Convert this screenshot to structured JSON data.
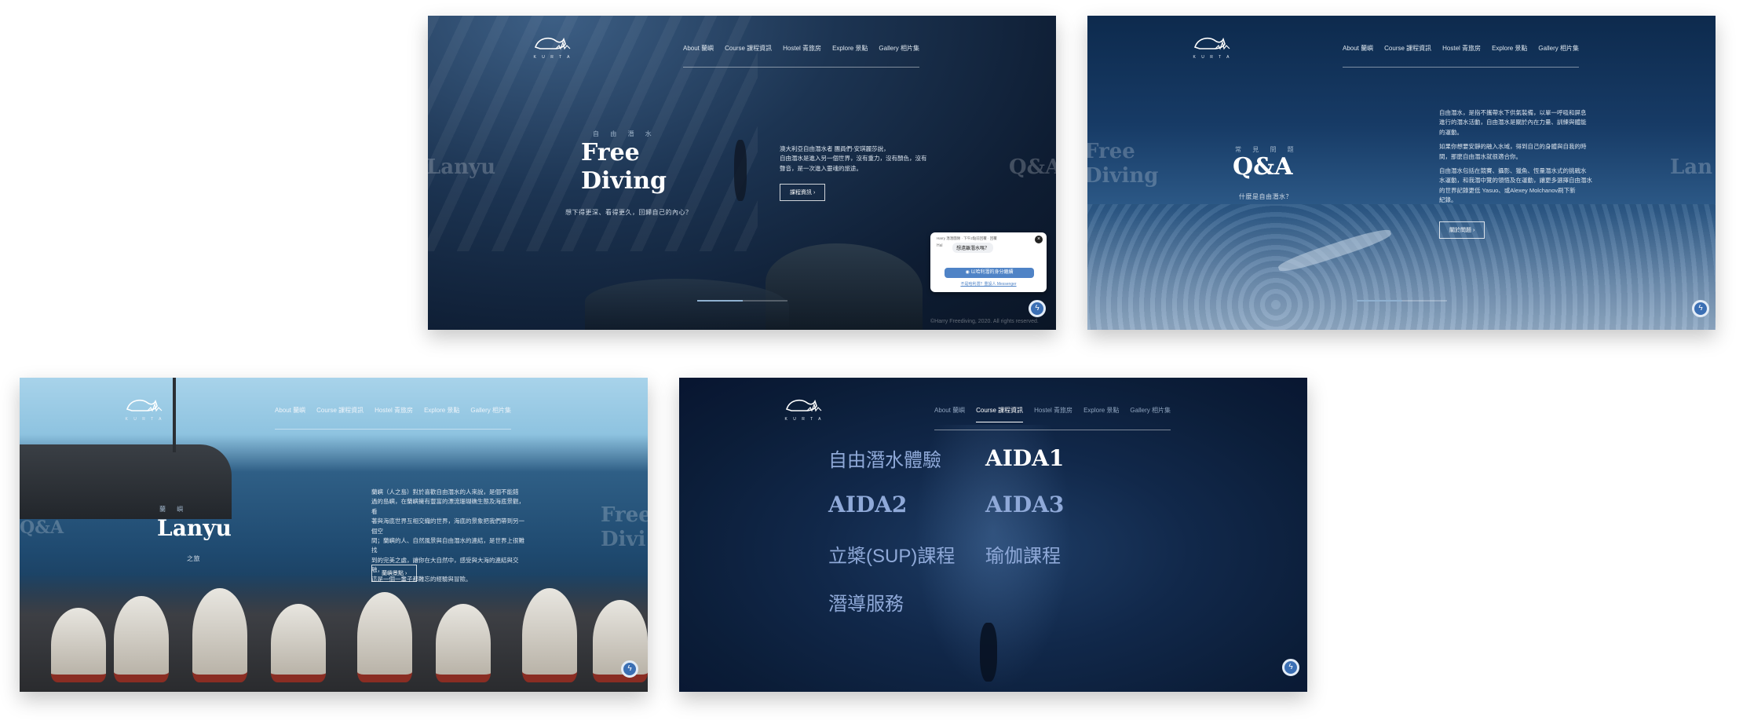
{
  "brand": {
    "logo_text": "K U R T A",
    "accent": "#8fa9d8",
    "messenger_color": "#3b6fb4"
  },
  "nav": [
    "About 蘭嶼",
    "Course 課程資訊",
    "Hostel 青旅房",
    "Explore 景點",
    "Gallery 相片集"
  ],
  "shot1": {
    "kicker": "自 由 潛 水",
    "title_line1": "Free",
    "title_line2": "Diving",
    "subtitle": "想下得更深、看得更久，回歸自己的內心？",
    "body": [
      "澳大利亞自由潛水者 團員們-安琪麗莎說，",
      "自由潛水是進入另一個世界，沒有重力，沒有顏色，沒有",
      "聲音，是一次進入靈魂的旅途。"
    ],
    "button": "課程資訊",
    "ghost_left": "Lanyu",
    "ghost_right": "Q&A",
    "copyright": "©Harry Freediving, 2020. All rights reserved.",
    "progress": 0.5,
    "popup": {
      "meta": "Harry 潛潛團隊 · 下午2點前回覆 · 回覆",
      "fb": "Hal",
      "greeting": "想遠離潛水嗎？",
      "cta": "以哈利潛的身分繼續",
      "link": "不是哈利潛？重設人 Messenger"
    }
  },
  "shot2": {
    "kicker": "常 見 問 題",
    "title": "Q&A",
    "subtitle": "什麼是自由潛水？",
    "body": [
      "自由潛水，是指不攜帶水下供氣裝備，以單一呼吸和屏息",
      "進行的潛水活動，自由潛水是關於內在力量、訓練與體能",
      "的運動。",
      "",
      "如果你想要安靜的融入水域，得到自己的身體與自我的時",
      "間，那麼自由潛水就很適合你。",
      "",
      "自由潛水包括在競賽、攝影、獵魚、恆量潛水式的挑戰水",
      "水運動，和我潛中覽的領悟及在運動，讓更多選擇自由潛水",
      "的世界記錄更低 Yasuo、或Alexey Molchanov刷下新",
      "紀錄。"
    ],
    "button": "關於問題",
    "ghost_left_line1": "Free",
    "ghost_left_line2": "Diving",
    "ghost_right": "Lan",
    "progress": 0.5
  },
  "shot3": {
    "kicker": "蘭 嶼",
    "title": "Lanyu",
    "subtitle": "之旅",
    "body": [
      "蘭嶼（人之島）對於喜歡自由潛水的人來說，是個不能錯",
      "過的島嶼，在蘭嶼擁有豐富的漂流珊瑚礁生態及海底景觀，看",
      "著與海底世界互相交織的世界，海底的景象把我們帶到另一個空",
      "間；蘭嶼的人、自然風景與自由潛水的連結，是世界上很難找",
      "到的完美之處，讓你在大自然中，感受與大海的連結與交融，",
      "這是一個一輩子都難忘的經驗與冒險。"
    ],
    "button": "蘭嶼景點",
    "ghost_left": "Q&A",
    "ghost_right_line1": "Free",
    "ghost_right_line2": "Divi"
  },
  "shot4": {
    "courses": [
      "自由潛水體驗",
      "AIDA1",
      "AIDA2",
      "AIDA3",
      "立槳(SUP)課程",
      "瑜伽課程",
      "潛導服務"
    ]
  }
}
